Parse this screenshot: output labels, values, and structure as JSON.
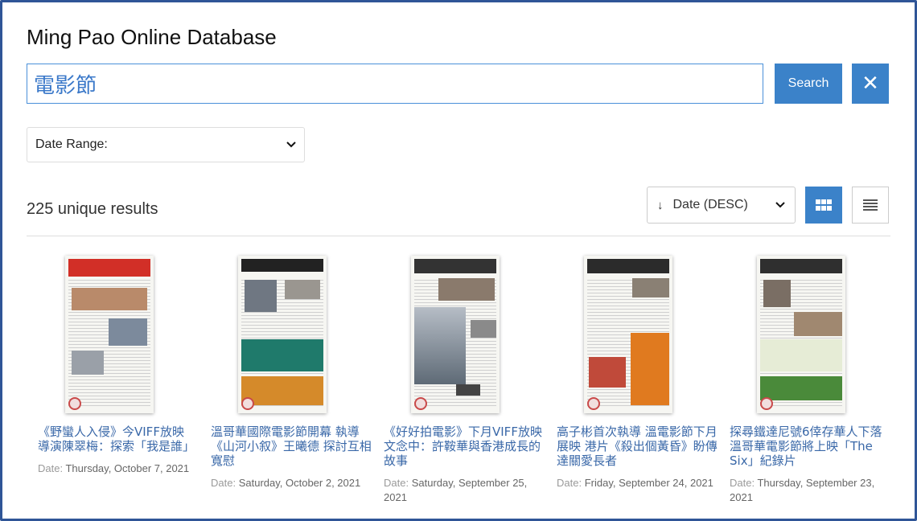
{
  "app": {
    "title": "Ming Pao Online Database"
  },
  "search": {
    "value": "電影節",
    "button_label": "Search",
    "clear_icon": "close-icon"
  },
  "filters": {
    "date_range_label": "Date Range:"
  },
  "results": {
    "count_text": "225 unique results"
  },
  "sort": {
    "label": "Date (DESC)",
    "direction_icon": "arrow-down-icon"
  },
  "view": {
    "active": "grid",
    "grid_icon": "grid-icon",
    "list_icon": "list-icon"
  },
  "colors": {
    "accent": "#3b82c9",
    "link": "#3a68a8",
    "frame": "#2f5597"
  },
  "cards": [
    {
      "title": "《野蠻人入侵》今VIFF放映 導演陳翠梅：探索「我是誰」",
      "date_label": "Date:",
      "date": "Thursday, October 7, 2021"
    },
    {
      "title": "溫哥華國際電影節開幕 執導《山河小叙》王曦德 探討互相寬慰",
      "date_label": "Date:",
      "date": "Saturday, October 2, 2021"
    },
    {
      "title": "《好好拍電影》下月VIFF放映 文念中：許鞍華與香港成長的故事",
      "date_label": "Date:",
      "date": "Saturday, September 25, 2021"
    },
    {
      "title": "高子彬首次執導 溫電影節下月展映 港片《殺出個黃昏》盼傳達關愛長者",
      "date_label": "Date:",
      "date": "Friday, September 24, 2021"
    },
    {
      "title": "探尋鐵達尼號6倖存華人下落 溫哥華電影節將上映「The Six」紀錄片",
      "date_label": "Date:",
      "date": "Thursday, September 23, 2021"
    }
  ]
}
